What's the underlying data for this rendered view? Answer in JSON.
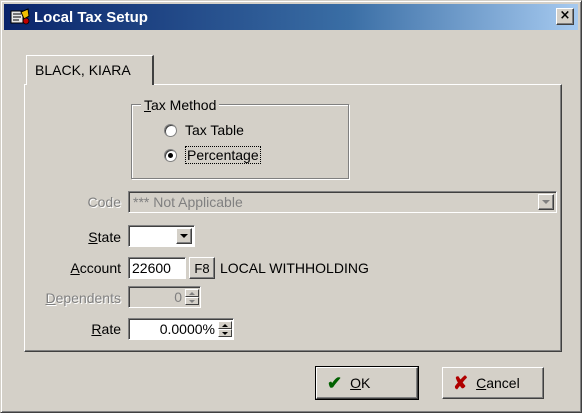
{
  "window": {
    "title": "Local Tax Setup",
    "close_label": "×"
  },
  "tab": {
    "label": "BLACK, KIARA"
  },
  "tax_method": {
    "legend_first": "T",
    "legend_rest": "ax Method",
    "options": [
      {
        "label": "Tax Table",
        "checked": false
      },
      {
        "label": "Percentage",
        "checked": true
      }
    ]
  },
  "fields": {
    "code": {
      "label": "Code",
      "value": "*** Not Applicable",
      "disabled": true
    },
    "state": {
      "label_first": "S",
      "label_rest": "tate",
      "value": ""
    },
    "account": {
      "label_first": "A",
      "label_rest": "ccount",
      "value": "22600",
      "lookup_button": "F8",
      "description": "LOCAL WITHHOLDING"
    },
    "dependents": {
      "label_first": "D",
      "label_rest": "ependents",
      "value": "0",
      "disabled": true
    },
    "rate": {
      "label_first": "R",
      "label_rest": "ate",
      "value": "0.0000%"
    }
  },
  "buttons": {
    "ok": {
      "first": "O",
      "rest": "K",
      "icon": "✔",
      "icon_color": "#006000"
    },
    "cancel": {
      "first": "C",
      "rest": "ancel",
      "icon": "✘",
      "icon_color": "#b00000"
    }
  },
  "colors": {
    "face": "#d4d0c8",
    "title_gradient_start": "#0a246a",
    "title_gradient_end": "#a6caf0",
    "disabled_text": "#808080"
  }
}
